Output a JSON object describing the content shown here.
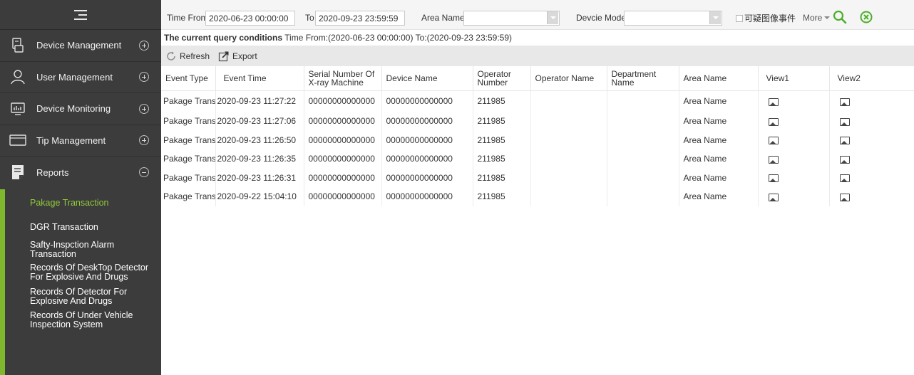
{
  "sidebar": {
    "menu": [
      {
        "label": "Device Management",
        "icon": "device-management-icon",
        "state": "collapsed"
      },
      {
        "label": "User Management",
        "icon": "user-icon",
        "state": "collapsed"
      },
      {
        "label": "Device Monitoring",
        "icon": "monitor-icon",
        "state": "collapsed"
      },
      {
        "label": "Tip Management",
        "icon": "tip-icon",
        "state": "collapsed"
      },
      {
        "label": "Reports",
        "icon": "reports-icon",
        "state": "expanded"
      }
    ],
    "submenu": [
      {
        "label": "Pakage Transaction",
        "active": true
      },
      {
        "label": "DGR Transaction",
        "active": false
      },
      {
        "label": "Safty-Inspction Alarm Transaction",
        "active": false
      },
      {
        "label": "Records Of DeskTop Detector For Explosive And Drugs",
        "active": false
      },
      {
        "label": "Records Of Detector For Explosive And Drugs",
        "active": false
      },
      {
        "label": "Records Of Under Vehicle Inspection System",
        "active": false
      }
    ],
    "accent_color": "#7fb82c"
  },
  "filters": {
    "time_from_label": "Time From",
    "time_from_value": "2020-06-23 00:00:00",
    "to_label": "To",
    "to_value": "2020-09-23 23:59:59",
    "area_name_label": "Area Name",
    "area_name_value": "",
    "device_model_label": "Devcie Model",
    "device_model_value": "",
    "checkbox_label": "可疑图像事件",
    "more_label": "More"
  },
  "query": {
    "label": "The current query conditions",
    "text": "Time From:(2020-06-23 00:00:00)  To:(2020-09-23 23:59:59)"
  },
  "toolbar": {
    "refresh_label": "Refresh",
    "export_label": "Export"
  },
  "table": {
    "headers": [
      "Event Type",
      "Event Time",
      "Serial Number Of X-ray Machine",
      "Device Name",
      "Operator Number",
      "Operator Name",
      "Department Name",
      "Area Name",
      "View1",
      "View2"
    ],
    "rows": [
      [
        "Pakage Transac",
        "2020-09-23 11:27:22",
        "00000000000000",
        "00000000000000",
        "211985",
        "",
        "",
        "Area Name"
      ],
      [
        "Pakage Transac",
        "2020-09-23 11:27:06",
        "00000000000000",
        "00000000000000",
        "211985",
        "",
        "",
        "Area Name"
      ],
      [
        "Pakage Transac",
        "2020-09-23 11:26:50",
        "00000000000000",
        "00000000000000",
        "211985",
        "",
        "",
        "Area Name"
      ],
      [
        "Pakage Transac",
        "2020-09-23 11:26:35",
        "00000000000000",
        "00000000000000",
        "211985",
        "",
        "",
        "Area Name"
      ],
      [
        "Pakage Transac",
        "2020-09-23 11:26:31",
        "00000000000000",
        "00000000000000",
        "211985",
        "",
        "",
        "Area Name"
      ],
      [
        "Pakage Transac",
        "2020-09-22 15:04:10",
        "00000000000000",
        "00000000000000",
        "211985",
        "",
        "",
        "Area Name"
      ]
    ]
  },
  "colors": {
    "search_icon": "#4caf2a",
    "clear_icon": "#4caf2a"
  }
}
